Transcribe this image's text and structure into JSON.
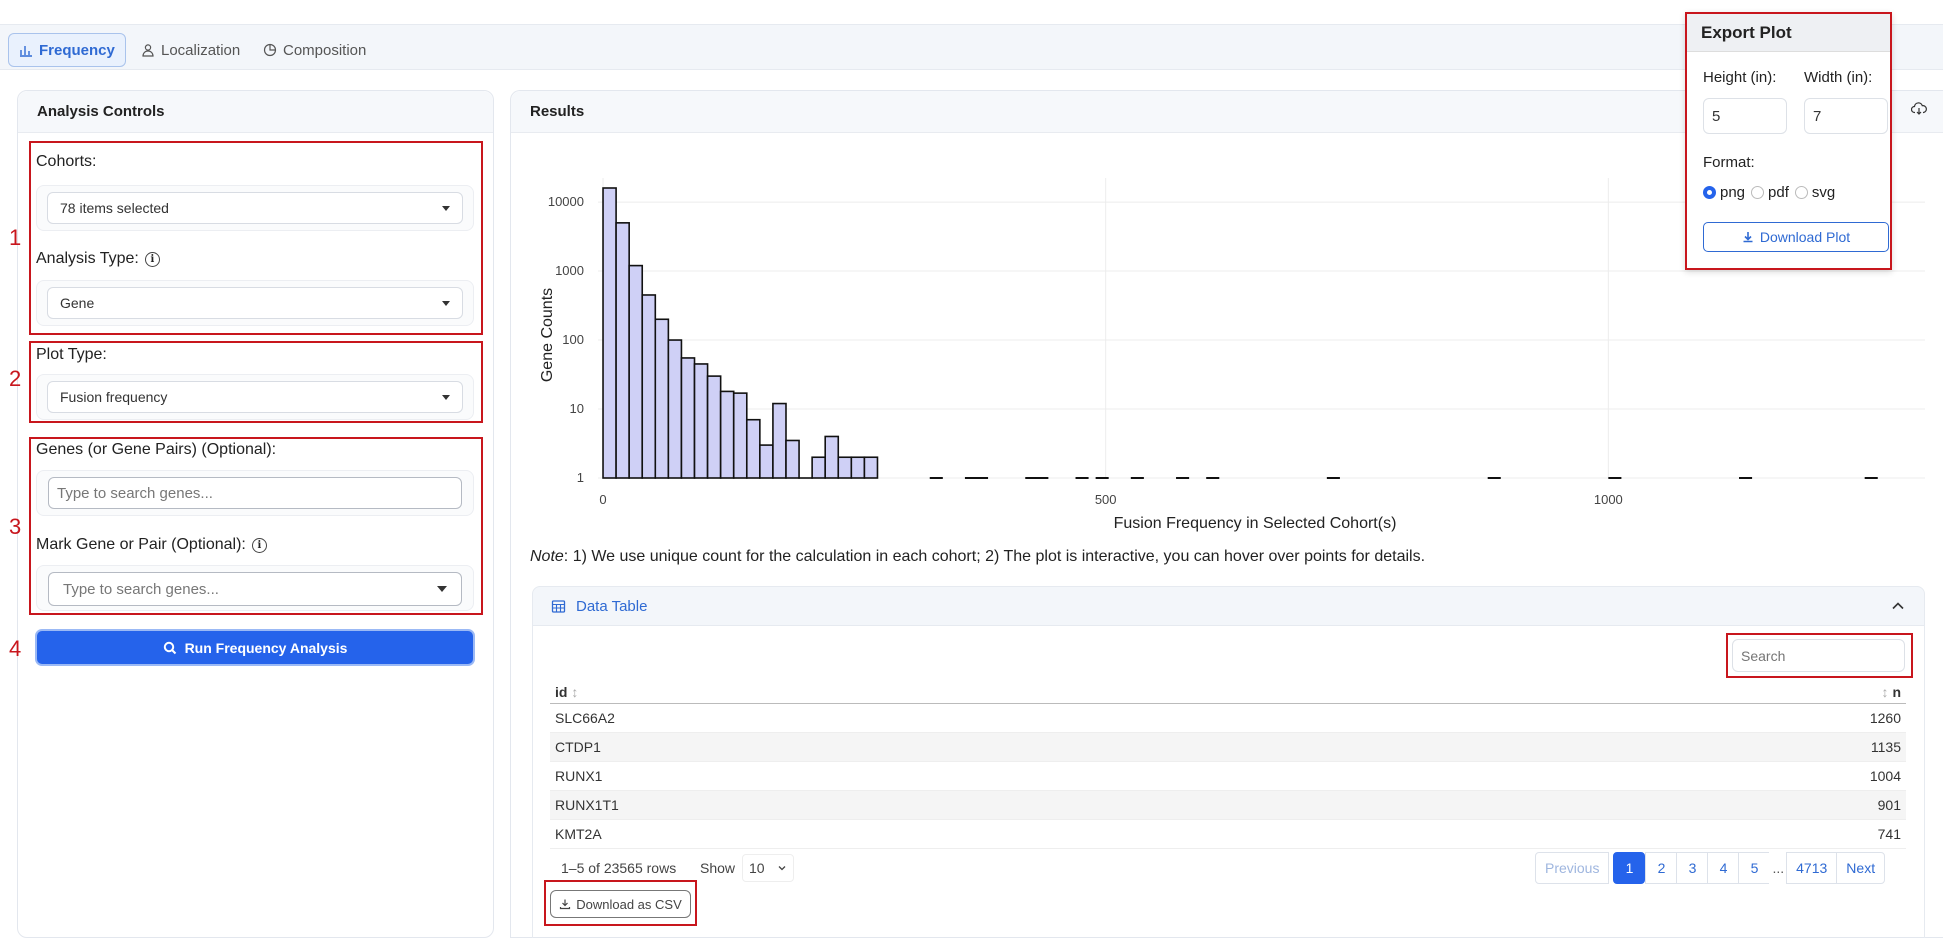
{
  "tabs": [
    {
      "label": "Frequency",
      "icon": "bar-chart-icon",
      "active": true
    },
    {
      "label": "Localization",
      "icon": "person-icon",
      "active": false
    },
    {
      "label": "Composition",
      "icon": "pie-chart-icon",
      "active": false
    }
  ],
  "controls": {
    "title": "Analysis Controls",
    "cohorts_label": "Cohorts:",
    "cohorts_value": "78 items selected",
    "analysis_type_label": "Analysis Type:",
    "analysis_type_value": "Gene",
    "plot_type_label": "Plot Type:",
    "plot_type_value": "Fusion frequency",
    "genes_label": "Genes (or Gene Pairs) (Optional):",
    "genes_placeholder": "Type to search genes...",
    "mark_label": "Mark Gene or Pair (Optional):",
    "mark_placeholder": "Type to search genes...",
    "run_label": "Run Frequency Analysis"
  },
  "steps": [
    "1",
    "2",
    "3",
    "4"
  ],
  "results": {
    "title": "Results",
    "note_prefix": "Note",
    "note_text": ": 1) We use unique count for the calculation in each cohort; 2) The plot is interactive, you can hover over points for details."
  },
  "chart_data": {
    "type": "bar",
    "xlabel": "Fusion Frequency in Selected Cohort(s)",
    "ylabel": "Gene Counts",
    "y_scale": "log",
    "x_ticks": [
      0,
      500,
      1000
    ],
    "y_ticks": [
      "1",
      "10",
      "100",
      "1000",
      "10000"
    ],
    "xlim": [
      -5,
      1315
    ],
    "ylim": [
      1,
      16000
    ],
    "bin_width": 13,
    "bins": [
      {
        "x0": 0,
        "count": 16000
      },
      {
        "x0": 13,
        "count": 5000
      },
      {
        "x0": 26,
        "count": 1200
      },
      {
        "x0": 39,
        "count": 450
      },
      {
        "x0": 52,
        "count": 200
      },
      {
        "x0": 65,
        "count": 100
      },
      {
        "x0": 78,
        "count": 55
      },
      {
        "x0": 91,
        "count": 45
      },
      {
        "x0": 104,
        "count": 30
      },
      {
        "x0": 117,
        "count": 18
      },
      {
        "x0": 130,
        "count": 17
      },
      {
        "x0": 143,
        "count": 7
      },
      {
        "x0": 156,
        "count": 3
      },
      {
        "x0": 169,
        "count": 12
      },
      {
        "x0": 182,
        "count": 3.5
      },
      {
        "x0": 195,
        "count": 1
      },
      {
        "x0": 208,
        "count": 2
      },
      {
        "x0": 221,
        "count": 4
      },
      {
        "x0": 234,
        "count": 2
      },
      {
        "x0": 247,
        "count": 2
      },
      {
        "x0": 260,
        "count": 2
      }
    ],
    "singletons": [
      325,
      360,
      370,
      420,
      430,
      470,
      490,
      525,
      570,
      600,
      720,
      880,
      1000,
      1130,
      1255
    ]
  },
  "data_table": {
    "title": "Data Table",
    "search_placeholder": "Search",
    "columns": [
      "id",
      "n"
    ],
    "rows": [
      {
        "id": "SLC66A2",
        "n": "1260"
      },
      {
        "id": "CTDP1",
        "n": "1135"
      },
      {
        "id": "RUNX1",
        "n": "1004"
      },
      {
        "id": "RUNX1T1",
        "n": "901"
      },
      {
        "id": "KMT2A",
        "n": "741"
      }
    ],
    "row_info": "1–5 of 23565 rows",
    "show_label": "Show",
    "show_value": "10",
    "pages": [
      "Previous",
      "1",
      "2",
      "3",
      "4",
      "5",
      "...",
      "4713",
      "Next"
    ],
    "download_csv": "Download as CSV"
  },
  "export_plot": {
    "title": "Export Plot",
    "height_label": "Height (in):",
    "height_value": "5",
    "width_label": "Width (in):",
    "width_value": "7",
    "format_label": "Format:",
    "formats": [
      "png",
      "pdf",
      "svg"
    ],
    "selected_format": "png",
    "download_label": "Download Plot"
  }
}
